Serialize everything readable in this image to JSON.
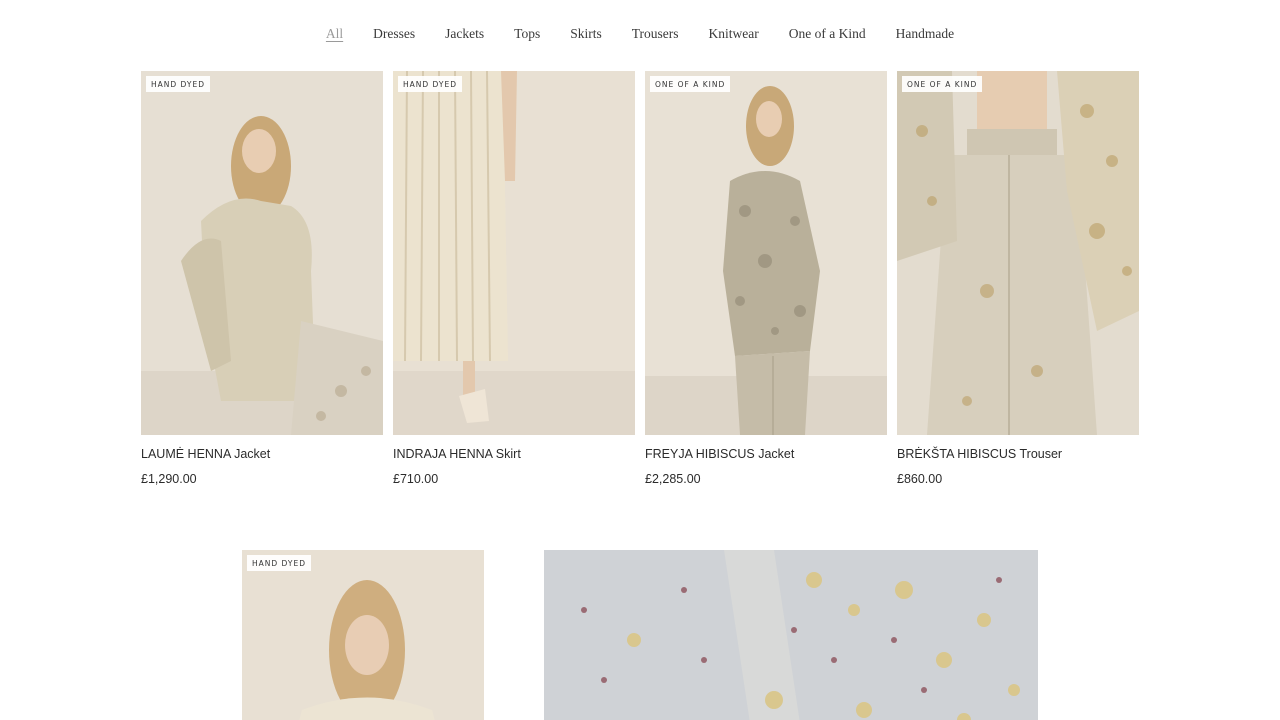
{
  "filters": [
    "All",
    "Dresses",
    "Jackets",
    "Tops",
    "Skirts",
    "Trousers",
    "Knitwear",
    "One of a Kind",
    "Handmade"
  ],
  "active_filter": "All",
  "products": [
    {
      "badge": "Hand Dyed",
      "name": "LAUMĖ HENNA Jacket",
      "price": "£1,290.00"
    },
    {
      "badge": "Hand Dyed",
      "name": "INDRAJA HENNA Skirt",
      "price": "£710.00"
    },
    {
      "badge": "One of a Kind",
      "name": "FREYJA HIBISCUS Jacket",
      "price": "£2,285.00"
    },
    {
      "badge": "One of a Kind",
      "name": "BRĖKŠTA HIBISCUS Trouser",
      "price": "£860.00"
    }
  ],
  "row2_product": {
    "badge": "Hand Dyed"
  },
  "colors": {
    "backdrop": "#e7e1d6",
    "fabric_cream": "#ded6c4",
    "hair": "#c9a877",
    "linen_grey": "#c9cdd2"
  }
}
